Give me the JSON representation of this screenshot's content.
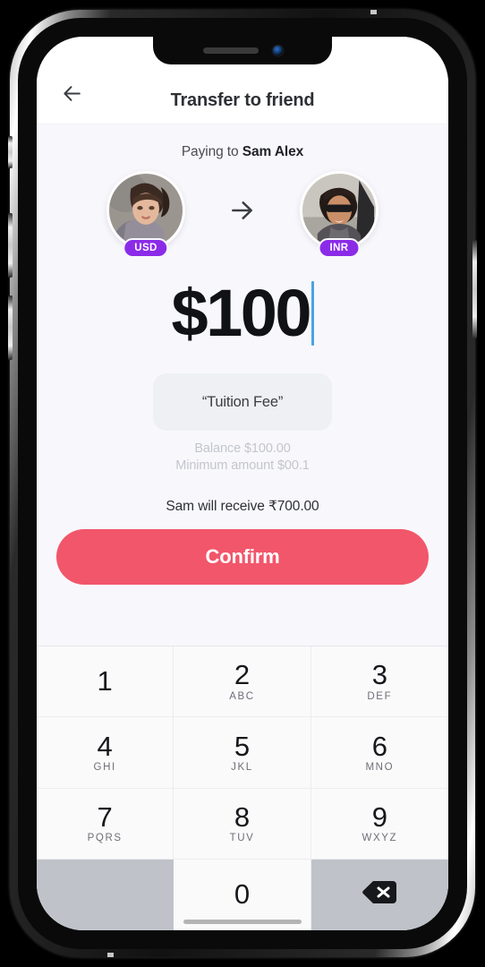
{
  "header": {
    "back_icon": "arrow-left-icon",
    "title": "Transfer to friend"
  },
  "transfer": {
    "paying_to_prefix": "Paying to ",
    "recipient_name": "Sam Alex",
    "sender_currency": "USD",
    "recipient_currency": "INR",
    "transfer_arrow_icon": "arrow-right-icon",
    "amount": "$100",
    "note": "“Tuition Fee”",
    "balance_text": "Balance $100.00",
    "minimum_text": "Minimum amount $00.1",
    "receive_text": "Sam will receive ₹700.00",
    "confirm_label": "Confirm"
  },
  "colors": {
    "accent_purple": "#8b2be8",
    "confirm_red": "#f2566b",
    "caret_blue": "#4ba3e3",
    "screen_bg": "#f8f8fc",
    "keypad_bg": "#fafafa",
    "key_gray": "#bfc3c9"
  },
  "keypad": {
    "keys": [
      {
        "num": "1",
        "sub": ""
      },
      {
        "num": "2",
        "sub": "ABC"
      },
      {
        "num": "3",
        "sub": "DEF"
      },
      {
        "num": "4",
        "sub": "GHI"
      },
      {
        "num": "5",
        "sub": "JKL"
      },
      {
        "num": "6",
        "sub": "MNO"
      },
      {
        "num": "7",
        "sub": "PQRS"
      },
      {
        "num": "8",
        "sub": "TUV"
      },
      {
        "num": "9",
        "sub": "WXYZ"
      },
      {
        "num": "",
        "sub": ""
      },
      {
        "num": "0",
        "sub": ""
      },
      {
        "num": "",
        "sub": "",
        "icon": "backspace-icon"
      }
    ]
  }
}
